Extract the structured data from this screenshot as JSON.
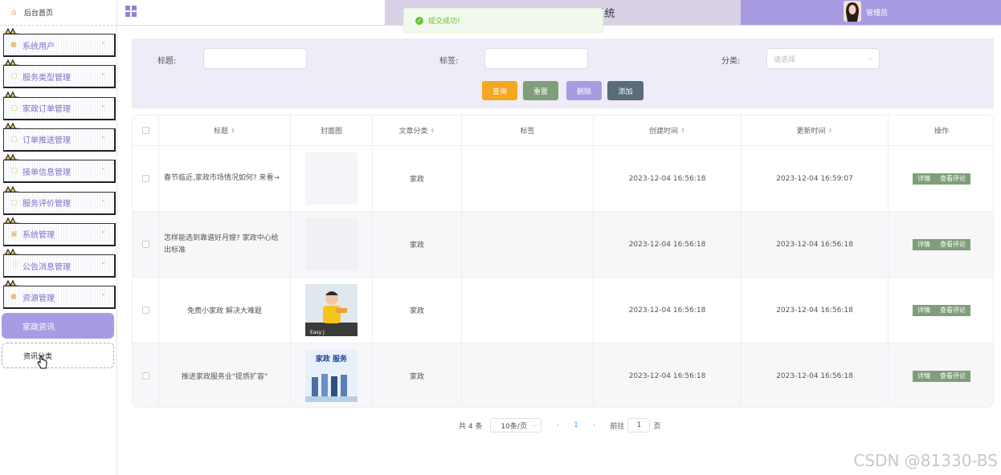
{
  "sidebar": {
    "home": "后台首页",
    "menu": [
      "系统用户",
      "服务类型管理",
      "家政订单管理",
      "订单推送管理",
      "接单信息管理",
      "服务评价管理",
      "系统管理",
      "公告消息管理",
      "资源管理"
    ],
    "active_item": "家政资讯",
    "sub_item": "资讯分类"
  },
  "header": {
    "title": "助家公司智能家政系统",
    "user": "管理员"
  },
  "toast": "提交成功!",
  "search": {
    "title_label": "标题:",
    "tag_label": "标签:",
    "category_label": "分类:",
    "category_placeholder": "请选择",
    "buttons": {
      "query": "查询",
      "reset": "重置",
      "delete": "删除",
      "add": "添加"
    }
  },
  "colors": {
    "accent": "#a99be2",
    "query": "#f5a623",
    "reset": "#7f9e7a",
    "delete": "#a99be2",
    "add": "#5a6b7a"
  },
  "table": {
    "headers": {
      "title": "标题",
      "cover": "封面图",
      "category": "文章分类",
      "tag": "标签",
      "created": "创建时间",
      "updated": "更新时间",
      "ops": "操作"
    },
    "rows": [
      {
        "title": "春节临近,家政市场情况如何? 来看→",
        "category": "家政",
        "tag": "",
        "created": "2023-12-04 16:56:18",
        "updated": "2023-12-04 16:59:07"
      },
      {
        "title": "怎样能选到靠谱好月嫂? 家政中心给出标准",
        "category": "家政",
        "tag": "",
        "created": "2023-12-04 16:56:18",
        "updated": "2023-12-04 16:56:18"
      },
      {
        "title": "免费小家政 解决大难题",
        "category": "家政",
        "tag": "",
        "created": "2023-12-04 16:56:18",
        "updated": "2023-12-04 16:56:18"
      },
      {
        "title": "推进家政服务业\"提质扩容\"",
        "category": "家政",
        "tag": "",
        "created": "2023-12-04 16:56:18",
        "updated": "2023-12-04 16:56:18"
      }
    ],
    "op_detail": "详情",
    "op_comments": "查看评论",
    "thumb2_text": "家政 服务"
  },
  "pager": {
    "total": "共 4 条",
    "size": "10条/页",
    "prev": "‹",
    "page": "1",
    "next": "›",
    "goto": "前往",
    "goto_value": "1",
    "page_unit": "页"
  },
  "watermark": "CSDN @81330-BS"
}
